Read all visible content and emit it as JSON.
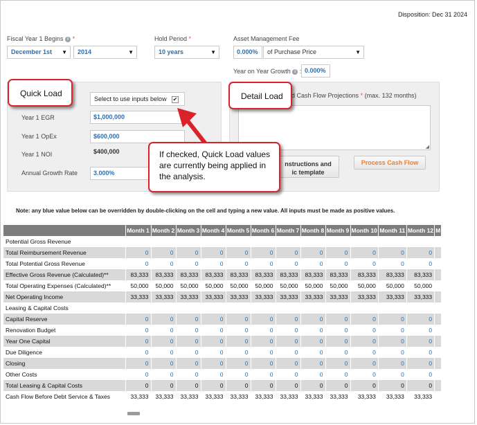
{
  "disposition": "Disposition: Dec 31 2024",
  "fiscal_year": {
    "label": "Fiscal Year 1 Begins",
    "required": "*",
    "month": "December 1st",
    "year": "2014"
  },
  "hold_period": {
    "label": "Hold Period",
    "required": "*",
    "value": "10 years"
  },
  "asset_mgmt": {
    "label": "Asset Management Fee",
    "value": "0.000%",
    "basis": "of Purchase Price"
  },
  "yoy_growth": {
    "label": "Year on Year Growth",
    "colon": ":",
    "value": "0.000%"
  },
  "quick_load": {
    "callout": "Quick Load",
    "checkbox_label": "Select to use inputs below",
    "checked": true,
    "egr_label": "Year 1 EGR",
    "egr_value": "$1,000,000",
    "opex_label": "Year 1 OpEx",
    "opex_value": "$600,000",
    "noi_label": "Year 1 NOI",
    "noi_value": "$400,000",
    "growth_label": "Annual Growth Rate",
    "growth_value": "3.000%"
  },
  "detail_load": {
    "callout": "Detail Load",
    "textarea_label_visible": "ed Cash Flow Projections",
    "required": "*",
    "max_note": "(max. 132 months)",
    "instructions_button": "nstructions and\nic template",
    "process_button": "Process Cash Flow"
  },
  "tooltip_callout": "If checked, Quick Load values are currently being applied in the analysis.",
  "note": "Note: any blue value below can be overridden by double-clicking on the cell and typing a new value. All inputs must be made as positive values.",
  "table": {
    "months": [
      "Month 1",
      "Month 2",
      "Month 3",
      "Month 4",
      "Month 5",
      "Month 6",
      "Month 7",
      "Month 8",
      "Month 9",
      "Month 10",
      "Month 11",
      "Month 12",
      "M"
    ],
    "rows": [
      {
        "label": "Potential Gross Revenue",
        "values": [
          "",
          "",
          "",
          "",
          "",
          "",
          "",
          "",
          "",
          "",
          "",
          "",
          ""
        ],
        "color": "blk",
        "shade": false
      },
      {
        "label": "Total Reimbursement Revenue",
        "values": [
          "0",
          "0",
          "0",
          "0",
          "0",
          "0",
          "0",
          "0",
          "0",
          "0",
          "0",
          "0",
          ""
        ],
        "color": "blue",
        "shade": true
      },
      {
        "label": "Total Potential Gross Revenue",
        "values": [
          "0",
          "0",
          "0",
          "0",
          "0",
          "0",
          "0",
          "0",
          "0",
          "0",
          "0",
          "0",
          ""
        ],
        "color": "blue",
        "shade": false
      },
      {
        "label": "Effective Gross Revenue (Calculated)**",
        "values": [
          "83,333",
          "83,333",
          "83,333",
          "83,333",
          "83,333",
          "83,333",
          "83,333",
          "83,333",
          "83,333",
          "83,333",
          "83,333",
          "83,333",
          ""
        ],
        "color": "blk",
        "shade": true
      },
      {
        "label": "Total Operating Expenses (Calculated)**",
        "values": [
          "50,000",
          "50,000",
          "50,000",
          "50,000",
          "50,000",
          "50,000",
          "50,000",
          "50,000",
          "50,000",
          "50,000",
          "50,000",
          "50,000",
          ""
        ],
        "color": "blk",
        "shade": false
      },
      {
        "label": "Net Operating Income",
        "values": [
          "33,333",
          "33,333",
          "33,333",
          "33,333",
          "33,333",
          "33,333",
          "33,333",
          "33,333",
          "33,333",
          "33,333",
          "33,333",
          "33,333",
          ""
        ],
        "color": "blk",
        "shade": true
      },
      {
        "label": "Leasing & Capital Costs",
        "values": [
          "",
          "",
          "",
          "",
          "",
          "",
          "",
          "",
          "",
          "",
          "",
          "",
          ""
        ],
        "color": "blk",
        "shade": false
      },
      {
        "label": "Capital Reserve",
        "values": [
          "0",
          "0",
          "0",
          "0",
          "0",
          "0",
          "0",
          "0",
          "0",
          "0",
          "0",
          "0",
          ""
        ],
        "color": "blue",
        "shade": true
      },
      {
        "label": "Renovation Budget",
        "values": [
          "0",
          "0",
          "0",
          "0",
          "0",
          "0",
          "0",
          "0",
          "0",
          "0",
          "0",
          "0",
          ""
        ],
        "color": "blue",
        "shade": false
      },
      {
        "label": "Year One Capital",
        "values": [
          "0",
          "0",
          "0",
          "0",
          "0",
          "0",
          "0",
          "0",
          "0",
          "0",
          "0",
          "0",
          ""
        ],
        "color": "blue",
        "shade": true
      },
      {
        "label": "Due Diligence",
        "values": [
          "0",
          "0",
          "0",
          "0",
          "0",
          "0",
          "0",
          "0",
          "0",
          "0",
          "0",
          "0",
          ""
        ],
        "color": "blue",
        "shade": false
      },
      {
        "label": "Closing",
        "values": [
          "0",
          "0",
          "0",
          "0",
          "0",
          "0",
          "0",
          "0",
          "0",
          "0",
          "0",
          "0",
          ""
        ],
        "color": "blue",
        "shade": true
      },
      {
        "label": "Other Costs",
        "values": [
          "0",
          "0",
          "0",
          "0",
          "0",
          "0",
          "0",
          "0",
          "0",
          "0",
          "0",
          "0",
          ""
        ],
        "color": "blue",
        "shade": false
      },
      {
        "label": "Total Leasing & Capital Costs",
        "values": [
          "0",
          "0",
          "0",
          "0",
          "0",
          "0",
          "0",
          "0",
          "0",
          "0",
          "0",
          "0",
          ""
        ],
        "color": "blk",
        "shade": true
      },
      {
        "label": "Cash Flow Before Debt Service & Taxes",
        "values": [
          "33,333",
          "33,333",
          "33,333",
          "33,333",
          "33,333",
          "33,333",
          "33,333",
          "33,333",
          "33,333",
          "33,333",
          "33,333",
          "33,333",
          ""
        ],
        "color": "blk",
        "shade": false
      }
    ]
  }
}
